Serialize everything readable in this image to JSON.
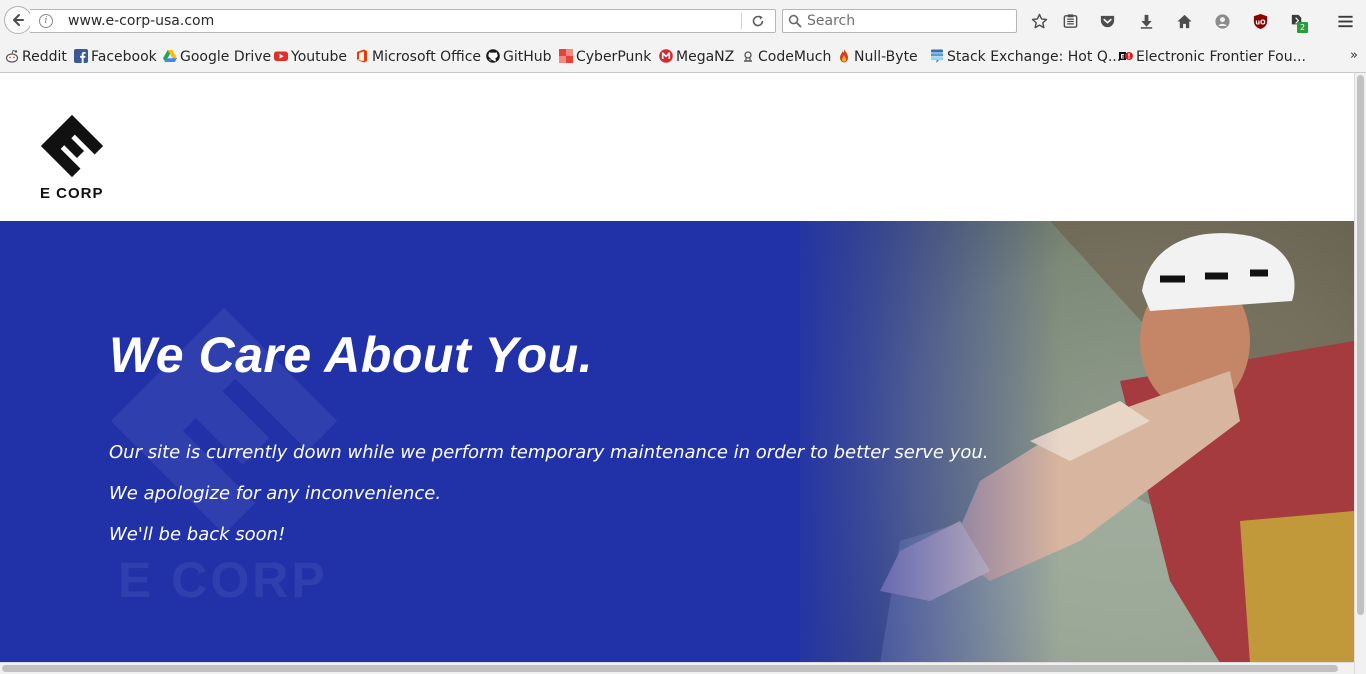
{
  "browser": {
    "url": "www.e-corp-usa.com",
    "search_placeholder": "Search",
    "notification_count": "2",
    "icons": [
      "back-icon",
      "info-icon",
      "reload-icon",
      "search-icon",
      "star-icon",
      "reading-list-icon",
      "pocket-icon",
      "download-icon",
      "home-icon",
      "account-icon",
      "ublock-icon",
      "extension-icon",
      "menu-icon",
      "bookmarks-overflow-icon"
    ]
  },
  "bookmarks": [
    {
      "label": "Reddit",
      "icon": "reddit-icon"
    },
    {
      "label": "Facebook",
      "icon": "facebook-icon"
    },
    {
      "label": "Google Drive",
      "icon": "google-drive-icon"
    },
    {
      "label": "Youtube",
      "icon": "youtube-icon"
    },
    {
      "label": "Microsoft Office",
      "icon": "office-icon"
    },
    {
      "label": "GitHub",
      "icon": "github-icon"
    },
    {
      "label": "CyberPunk",
      "icon": "cyberpunk-icon"
    },
    {
      "label": "MegaNZ",
      "icon": "mega-icon"
    },
    {
      "label": "CodeMuch",
      "icon": "codemuch-icon"
    },
    {
      "label": "Null-Byte",
      "icon": "null-byte-icon"
    },
    {
      "label": "Stack Exchange: Hot Q...",
      "icon": "stack-exchange-icon"
    },
    {
      "label": "Electronic Frontier Fou...",
      "icon": "eff-icon"
    }
  ],
  "page": {
    "logo_text": "E CORP",
    "watermark_text": "E CORP",
    "headline": "We Care About You.",
    "lines": [
      "Our site is currently down while we perform temporary maintenance in order to better serve you.",
      "We apologize for any inconvenience.",
      "We'll be back soon!"
    ]
  },
  "colors": {
    "hero_blue": "#2131a8",
    "toolbar_bg": "#f3f3f3",
    "ublock_red": "#8b0000",
    "badge_green": "#2e9a3e"
  }
}
